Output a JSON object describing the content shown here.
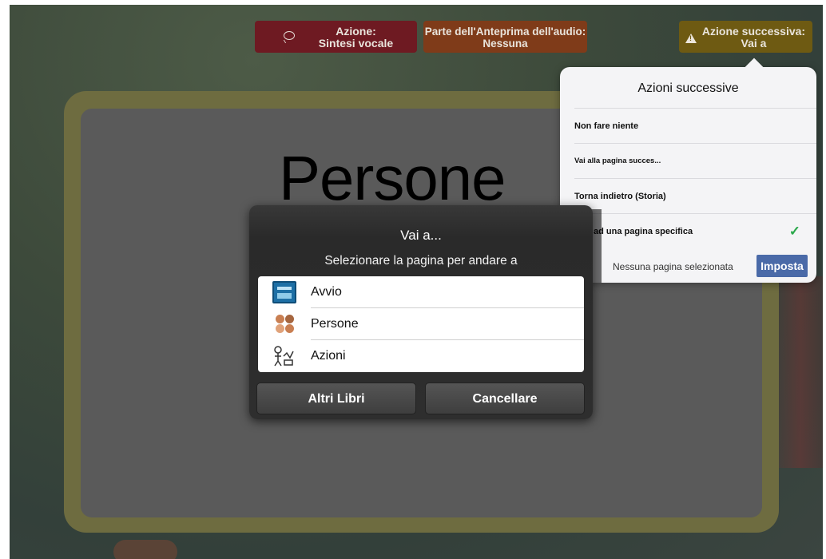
{
  "toolbar": {
    "speech_line1": "Azione:",
    "speech_line2": "Sintesi vocale",
    "audio_line1": "Parte dell'Anteprima dell'audio:",
    "audio_line2": "Nessuna",
    "next_line1": "Azione successiva:",
    "next_line2": "Vai a"
  },
  "card": {
    "title": "Persone"
  },
  "popover": {
    "title": "Azioni successive",
    "items": [
      {
        "label": "Non fare niente"
      },
      {
        "label": "Vai alla pagina succes..."
      },
      {
        "label": "Torna indietro (Storia)"
      },
      {
        "label": "ad una pagina specifica",
        "selected": true
      }
    ],
    "no_page_text": "Nessuna pagina selezionata",
    "set_button": "Imposta",
    "check_color": "#2aa84a"
  },
  "dialog": {
    "title": "Vai a...",
    "subtitle": "Selezionare la pagina per andare a",
    "pages": [
      {
        "label": "Avvio",
        "icon": "board-icon"
      },
      {
        "label": "Persone",
        "icon": "people-icon"
      },
      {
        "label": "Azioni",
        "icon": "actions-icon"
      }
    ],
    "other_books_button": "Altri Libri",
    "cancel_button": "Cancellare"
  }
}
